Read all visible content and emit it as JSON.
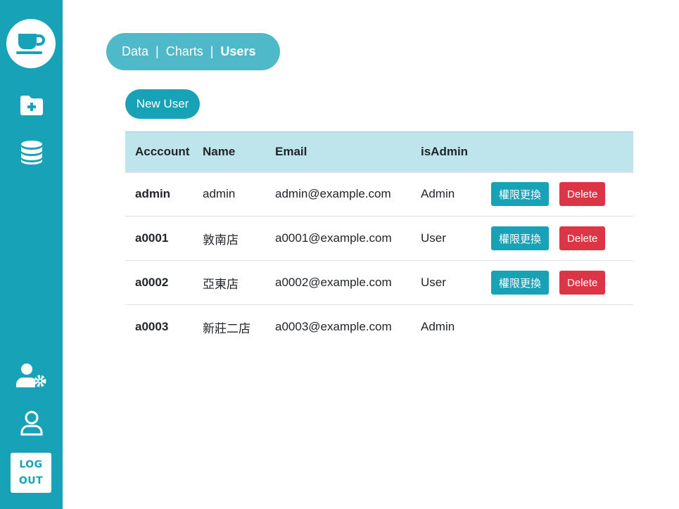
{
  "sidebar": {
    "logo_icon": "coffee-cup-icon",
    "top_items": [
      {
        "icon": "folder-plus-icon"
      },
      {
        "icon": "database-icon"
      }
    ],
    "bottom_items": [
      {
        "icon": "user-settings-icon"
      },
      {
        "icon": "user-profile-icon"
      }
    ],
    "logout": {
      "line1": "LOG",
      "line2": "OUT"
    },
    "color": "#17a2b8"
  },
  "nav": {
    "tabs": [
      {
        "label": "Data"
      },
      {
        "label": "Charts"
      },
      {
        "label": "Users",
        "active": true
      }
    ],
    "separator": "|"
  },
  "actions": {
    "new_user_label": "New User"
  },
  "table": {
    "headers": [
      "Acccount",
      "Name",
      "Email",
      "isAdmin"
    ],
    "rows": [
      {
        "account": "admin",
        "name": "admin",
        "email": "admin@example.com",
        "role": "Admin",
        "permission_label": "權限更換",
        "delete_label": "Delete"
      },
      {
        "account": "a0001",
        "name": "敦南店",
        "email": "a0001@example.com",
        "role": "User",
        "permission_label": "權限更換",
        "delete_label": "Delete"
      },
      {
        "account": "a0002",
        "name": "亞東店",
        "email": "a0002@example.com",
        "role": "User",
        "permission_label": "權限更換",
        "delete_label": "Delete"
      },
      {
        "account": "a0003",
        "name": "新莊二店",
        "email": "a0003@example.com",
        "role": "Admin"
      }
    ]
  },
  "colors": {
    "primary": "#17a2b8",
    "danger": "#dc3545",
    "header_bg": "#bee5eb"
  }
}
